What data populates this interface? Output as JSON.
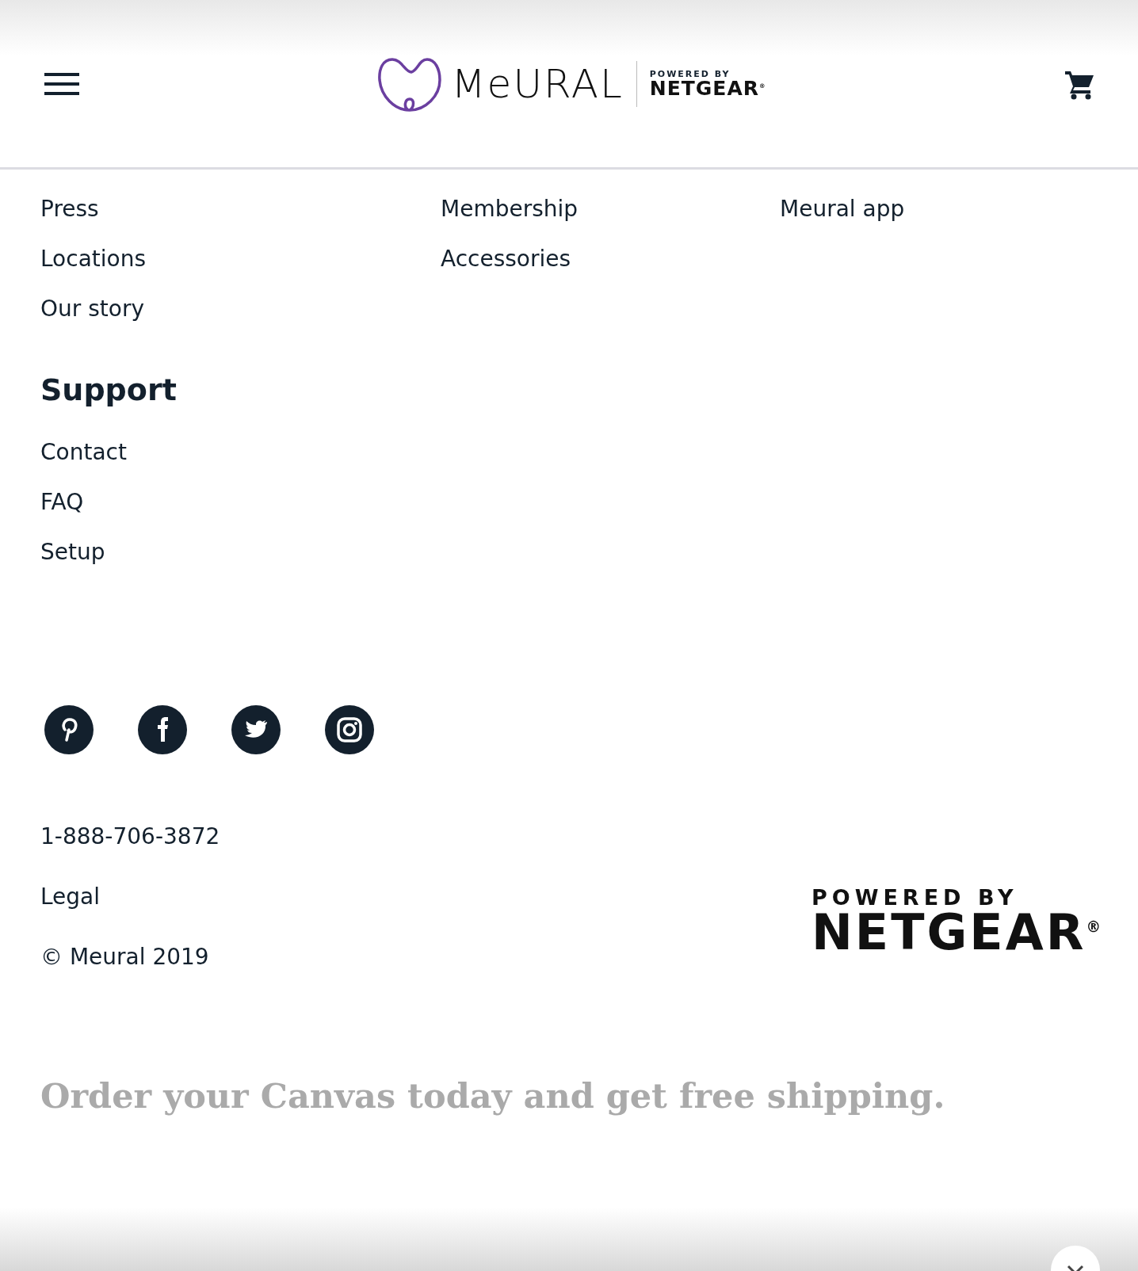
{
  "header": {
    "logo_wordmark": "MeURAL",
    "logo_tagline": "POWERED BY",
    "logo_brand": "NETGEAR$^{®}$"
  },
  "nav_columns": [
    {
      "links": [
        "Press",
        "Locations",
        "Our story"
      ]
    },
    {
      "links": [
        "Membership",
        "Accessories"
      ]
    },
    {
      "links": [
        "Meural app"
      ]
    }
  ],
  "support": {
    "title": "Support",
    "links": [
      "Contact",
      "FAQ",
      "Setup"
    ]
  },
  "social": [
    {
      "kind": "pinterest"
    },
    {
      "kind": "facebook"
    },
    {
      "kind": "twitter"
    },
    {
      "kind": "instagram"
    }
  ],
  "phone": "1-888-706-3872",
  "legal": "Legal",
  "copyright": "© Meural 2019",
  "footer_logo": {
    "tagline": "POWERED BY",
    "brand": "NETGEAR$^{®}$"
  },
  "promo": "Order your Canvas today and get free shipping."
}
